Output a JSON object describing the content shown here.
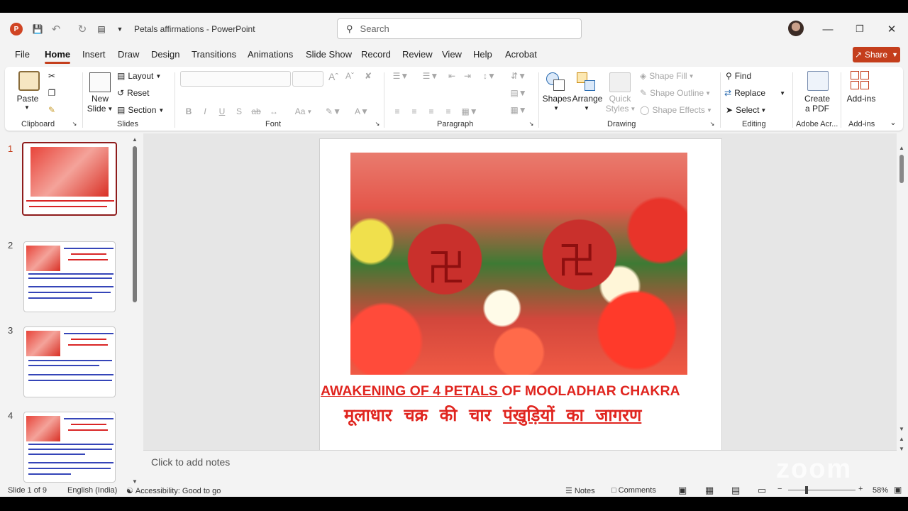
{
  "window": {
    "app_icon": "P",
    "doc_title": "Petals affirmations",
    "separator": " - ",
    "app_name": "PowerPoint",
    "search_placeholder": "Search"
  },
  "tabs": [
    "File",
    "Home",
    "Insert",
    "Draw",
    "Design",
    "Transitions",
    "Animations",
    "Slide Show",
    "Record",
    "Review",
    "View",
    "Help",
    "Acrobat"
  ],
  "active_tab": "Home",
  "share_label": "Share",
  "ribbon": {
    "clipboard": {
      "paste": "Paste",
      "group": "Clipboard"
    },
    "slides": {
      "new_slide_1": "New",
      "new_slide_2": "Slide",
      "layout": "Layout",
      "reset": "Reset",
      "section": "Section",
      "group": "Slides"
    },
    "font": {
      "bold": "B",
      "italic": "I",
      "underline": "U",
      "strike": "S",
      "aa": "Aa",
      "group": "Font"
    },
    "paragraph": {
      "group": "Paragraph"
    },
    "drawing": {
      "shapes": "Shapes",
      "arrange": "Arrange",
      "quick_styles_1": "Quick",
      "quick_styles_2": "Styles",
      "shape_fill": "Shape Fill",
      "shape_outline": "Shape Outline",
      "shape_effects": "Shape Effects",
      "group": "Drawing"
    },
    "editing": {
      "find": "Find",
      "replace": "Replace",
      "select": "Select",
      "group": "Editing"
    },
    "adobe": {
      "create_1": "Create",
      "create_2": "a PDF",
      "group": "Adobe Acr..."
    },
    "addins": {
      "label": "Add-ins",
      "group": "Add-ins"
    }
  },
  "thumbnails": [
    {
      "num": "1",
      "selected": true
    },
    {
      "num": "2",
      "selected": false
    },
    {
      "num": "3",
      "selected": false
    },
    {
      "num": "4",
      "selected": false
    }
  ],
  "slide": {
    "title_part1": "AWAKENING OF 4 PETALS ",
    "title_part2": "OF MOOLADHAR CHAKRA",
    "hindi_part1": "मूलाधार  चक्र  की  चार  ",
    "hindi_part2": "पंखुड़ियों  का  जागरण"
  },
  "notes_placeholder": "Click to add notes",
  "watermark": "zoom",
  "status": {
    "slide_info": "Slide 1 of 9",
    "language": "English (India)",
    "accessibility": "Accessibility: Good to go",
    "notes": "Notes",
    "comments": "Comments",
    "zoom": "58%"
  },
  "colors": {
    "accent": "#c43e1c",
    "slide_text": "#e0251f",
    "selected_thumb": "#8e1b1b"
  }
}
